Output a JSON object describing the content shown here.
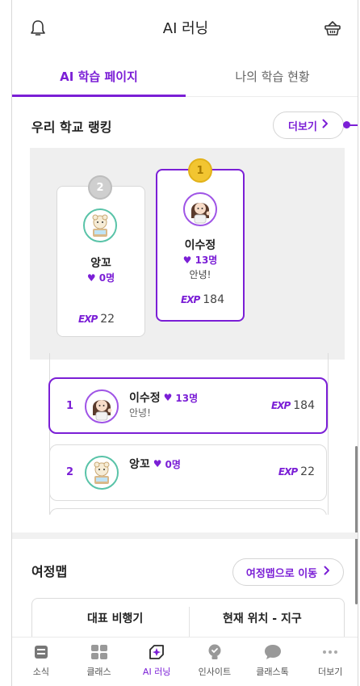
{
  "header": {
    "title": "AI 러닝",
    "left_icon": "bell-icon",
    "right_icon": "basket-icon"
  },
  "tabs": [
    {
      "label": "AI 학습 페이지",
      "active": true
    },
    {
      "label": "나의 학습 현황",
      "active": false
    }
  ],
  "ranking": {
    "title": "우리 학교 랭킹",
    "more_label": "더보기",
    "more_chevron": "›",
    "podium": {
      "first": {
        "medal": "1",
        "name": "이수정",
        "hearts": "13명",
        "message": "안녕!",
        "exp_tag": "EXP",
        "exp": "184"
      },
      "second": {
        "medal": "2",
        "name": "앙꼬",
        "hearts": "0명",
        "exp_tag": "EXP",
        "exp": "22"
      }
    },
    "list": [
      {
        "rank": "1",
        "name": "이수정",
        "hearts": "13명",
        "message": "안녕!",
        "exp_tag": "EXP",
        "exp": "184",
        "highlight": true
      },
      {
        "rank": "2",
        "name": "앙꼬",
        "hearts": "0명",
        "message": "",
        "exp_tag": "EXP",
        "exp": "22",
        "highlight": false
      }
    ]
  },
  "journey": {
    "title": "여정맵",
    "button_label": "여정맵으로 이동",
    "chevron": "›",
    "col_left": "대표 비행기",
    "col_right": "현재 위치 - 지구"
  },
  "bottom_nav": [
    {
      "label": "소식",
      "icon": "news-icon",
      "active": false
    },
    {
      "label": "클래스",
      "icon": "class-grid-icon",
      "active": false
    },
    {
      "label": "AI 러닝",
      "icon": "ai-learning-icon",
      "active": true
    },
    {
      "label": "인사이트",
      "icon": "insight-bulb-icon",
      "active": false
    },
    {
      "label": "클래스톡",
      "icon": "chat-bubble-icon",
      "active": false
    },
    {
      "label": "더보기",
      "icon": "more-dots-icon",
      "active": false
    }
  ],
  "colors": {
    "accent": "#7b1fd6",
    "podium_bg": "#efefef",
    "gold": "#f2c531",
    "silver": "#cfcfcf"
  }
}
